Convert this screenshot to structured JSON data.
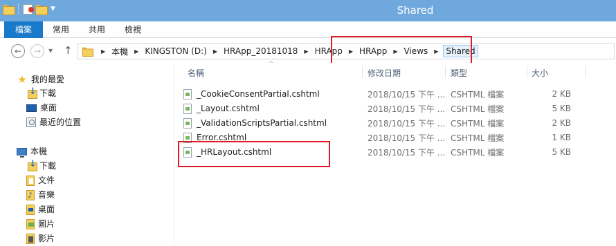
{
  "window": {
    "title": "Shared"
  },
  "quick_access": {
    "icons": [
      "folder-icon",
      "properties-icon",
      "new-folder-icon",
      "customize-dropdown-icon"
    ]
  },
  "ribbon": {
    "tabs": [
      "檔案",
      "常用",
      "共用",
      "檢視"
    ]
  },
  "address": {
    "crumbs": [
      "本機",
      "KINGSTON (D:)",
      "HRApp_20181018",
      "HRApp",
      "HRApp",
      "Views",
      "Shared"
    ]
  },
  "nav_pane": {
    "favorites": {
      "label": "我的最愛",
      "items": [
        "下載",
        "桌面",
        "最近的位置"
      ]
    },
    "this_pc": {
      "label": "本機",
      "items": [
        "下載",
        "文件",
        "音樂",
        "桌面",
        "圖片",
        "影片"
      ]
    }
  },
  "columns": {
    "name": "名稱",
    "date": "修改日期",
    "type": "類型",
    "size": "大小"
  },
  "files": [
    {
      "name": "_CookieConsentPartial.cshtml",
      "date": "2018/10/15 下午 ...",
      "type": "CSHTML 檔案",
      "size": "2 KB"
    },
    {
      "name": "_Layout.cshtml",
      "date": "2018/10/15 下午 ...",
      "type": "CSHTML 檔案",
      "size": "5 KB"
    },
    {
      "name": "_ValidationScriptsPartial.cshtml",
      "date": "2018/10/15 下午 ...",
      "type": "CSHTML 檔案",
      "size": "2 KB"
    },
    {
      "name": "Error.cshtml",
      "date": "2018/10/15 下午 ...",
      "type": "CSHTML 檔案",
      "size": "1 KB"
    },
    {
      "name": "_HRLayout.cshtml",
      "date": "2018/10/15 下午 ...",
      "type": "CSHTML 檔案",
      "size": "5 KB"
    }
  ],
  "colors": {
    "titlebar": "#6fa8dc",
    "file_tab": "#1979ca",
    "highlight_box": "#e01b24"
  }
}
